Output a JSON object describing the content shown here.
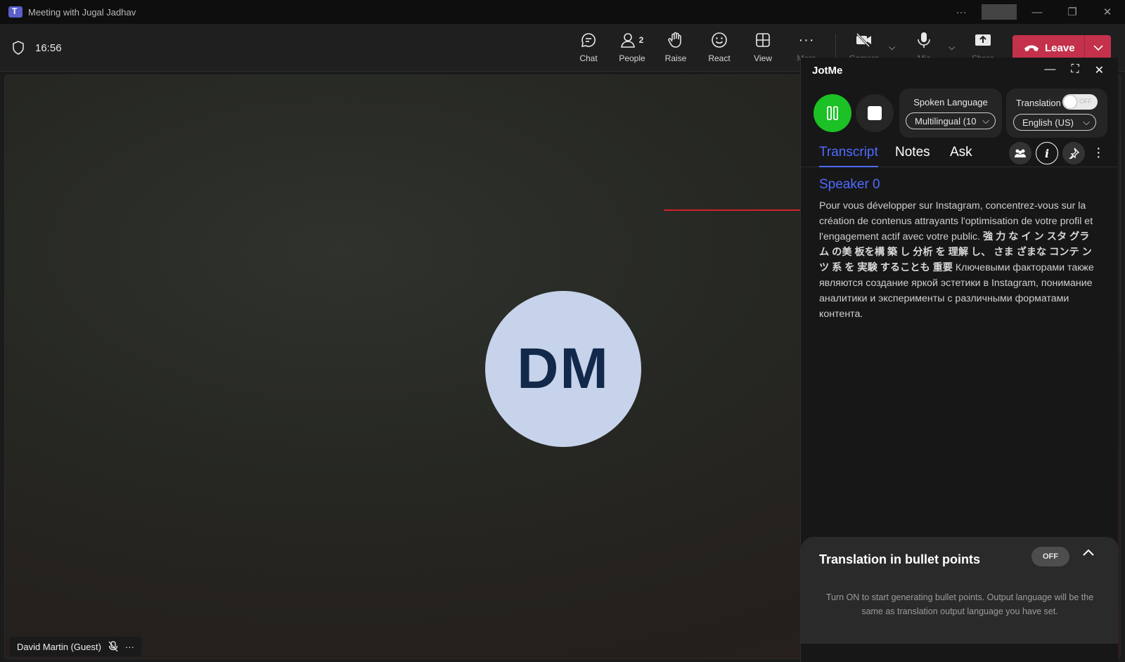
{
  "window": {
    "title": "Meeting with Jugal Jadhav"
  },
  "toolbar": {
    "time": "16:56",
    "chat": "Chat",
    "people": "People",
    "people_count": "2",
    "raise": "Raise",
    "react": "React",
    "view": "View",
    "more": "More",
    "camera": "Camera",
    "mic": "Mic",
    "share": "Share",
    "leave": "Leave",
    "leave_color": "#c4314b"
  },
  "participant": {
    "initials": "DM",
    "name": "David Martin (Guest)"
  },
  "jotme": {
    "title": "JotMe",
    "spoken_language_label": "Spoken Language",
    "spoken_language_value": "Multilingual (10",
    "translation_label": "Translation",
    "translation_toggle": "OFF",
    "translation_language": "English (US)",
    "tabs": [
      "Transcript",
      "Notes",
      "Ask"
    ],
    "active_tab": "Transcript",
    "accent": "#4f6bff",
    "speaker": "Speaker 0",
    "transcript_fr": "Pour vous développer sur Instagram, concentrez-vous sur la création de contenus attrayants l'optimisation de votre profil et l'engagement actif avec votre public.",
    "transcript_jp": "強 力 な イ ン スタ グラム の美 板を構 築 し 分析 を 理解 し、 さま ざまな コンテ ンツ 系 を 実験 することも 重要",
    "transcript_ru": "Ключевыми факторами также являются создание яркой эстетики в Instagram, понимание аналитики и эксперименты с различными форматами контента.",
    "bullets_title": "Translation in bullet points",
    "bullets_toggle": "OFF",
    "bullets_desc": "Turn ON to start generating bullet points. Output language will be the same as translation output language you have set."
  }
}
